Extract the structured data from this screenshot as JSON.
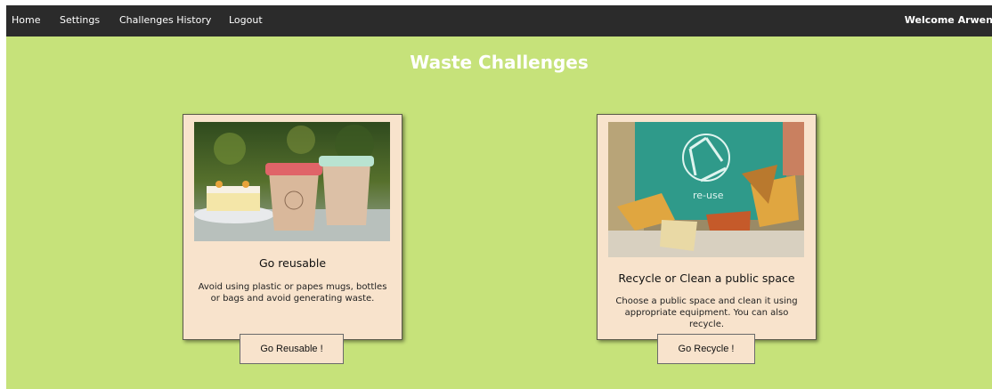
{
  "nav": {
    "home": "Home",
    "settings": "Settings",
    "history": "Challenges History",
    "logout": "Logout",
    "welcome": "Welcome Arwen!"
  },
  "page": {
    "title": "Waste Challenges"
  },
  "challenges": [
    {
      "title": "Go reusable",
      "description": "Avoid using plastic or papes mugs, bottles or bags and avoid generating waste.",
      "button": "Go Reusable !",
      "image_icon": "reusable-coffee-cups-photo"
    },
    {
      "title": "Recycle or Clean a public space",
      "description": "Choose a public space and clean it using appropriate equipment. You can also recycle.",
      "button": "Go Recycle !",
      "image_icon": "recycle-bag-photo",
      "image_text": "re-use"
    }
  ],
  "colors": {
    "background": "#c6e27a",
    "navbar": "#2b2b2b",
    "card": "#f8e3cc"
  }
}
